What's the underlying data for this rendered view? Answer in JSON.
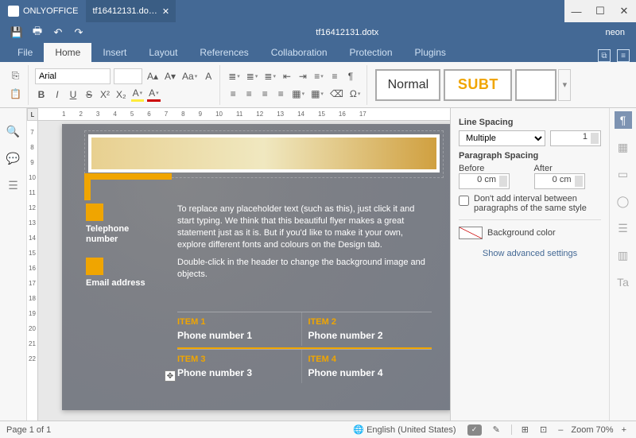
{
  "app": {
    "brand": "ONLYOFFICE",
    "user": "neon"
  },
  "tab": {
    "title": "tf16412131.do…",
    "doc_title": "tf16412131.dotx"
  },
  "window_controls": {
    "min": "—",
    "max": "☐",
    "close": "✕"
  },
  "quick": {
    "save": "💾",
    "print": "🖶",
    "undo": "↶",
    "redo": "↷"
  },
  "menu": {
    "items": [
      "File",
      "Home",
      "Insert",
      "Layout",
      "References",
      "Collaboration",
      "Protection",
      "Plugins"
    ],
    "active_index": 1
  },
  "ribbon": {
    "clipboard": {
      "copy": "⎘",
      "paste": "📋"
    },
    "font_name": "Arial",
    "font_size": "",
    "inc": "A▴",
    "dec": "A▾",
    "case": "Aa",
    "marker": "A",
    "bold": "B",
    "italic": "I",
    "underline": "U",
    "strike": "S",
    "sup": "X²",
    "sub": "X₂",
    "highlight": "A",
    "color": "A",
    "bullets": "≣",
    "numbers": "≣",
    "multilevel": "≣",
    "dedent": "⇤",
    "indent": "⇥",
    "lineheight": "≡",
    "sort": "≡",
    "pilcrow": "¶",
    "align_l": "≡",
    "align_c": "≡",
    "align_r": "≡",
    "align_j": "≡",
    "shading": "▦",
    "borders": "▦",
    "clear": "⌫",
    "special": "Ω",
    "styles": {
      "normal": "Normal",
      "subt": "SUBT"
    }
  },
  "left_tools": {
    "search": "🔍",
    "comments": "💬",
    "headings": "☰"
  },
  "right_tools": {
    "paragraph": "¶",
    "table": "▦",
    "image": "▭",
    "shape": "◯",
    "header": "☰",
    "chart": "▥",
    "text": "Ta"
  },
  "ruler": {
    "corner": "L",
    "h": [
      "",
      "1",
      "2",
      "3",
      "4",
      "5",
      "6",
      "7",
      "8",
      "9",
      "10",
      "11",
      "12",
      "13",
      "14",
      "15",
      "16",
      "17"
    ],
    "v": [
      "7",
      "8",
      "9",
      "10",
      "11",
      "12",
      "13",
      "14",
      "15",
      "16",
      "17",
      "18",
      "19",
      "20",
      "21",
      "22"
    ]
  },
  "doc": {
    "tel_label": "Telephone number",
    "email_label": "Email address",
    "para1": "To replace any placeholder text (such as this), just click it and start typing. We think that this beautiful flyer makes a great statement just as it is. But if you'd like to make it your own, explore different fonts and colours on the Design tab.",
    "para2": "Double-click in the header to change the background image and objects.",
    "items": [
      {
        "name": "ITEM 1",
        "phone": "Phone number 1"
      },
      {
        "name": "ITEM 2",
        "phone": "Phone number 2"
      },
      {
        "name": "ITEM 3",
        "phone": "Phone number 3"
      },
      {
        "name": "ITEM 4",
        "phone": "Phone number 4"
      }
    ],
    "table_handle": "✥"
  },
  "panel": {
    "line_spacing_title": "Line Spacing",
    "line_spacing_mode": "Multiple",
    "line_spacing_value": "1",
    "para_spacing_title": "Paragraph Spacing",
    "before_label": "Before",
    "after_label": "After",
    "before_value": "0 cm",
    "after_value": "0 cm",
    "no_interval": "Don't add interval between paragraphs of the same style",
    "bg_color_label": "Background color",
    "advanced": "Show advanced settings"
  },
  "status": {
    "page": "Page 1 of 1",
    "lang": "English (United States)",
    "spell": "✓",
    "track": "✎",
    "fit1": "⊞",
    "fit2": "⊡",
    "zoom_out": "–",
    "zoom_in": "+",
    "zoom": "Zoom 70%"
  }
}
